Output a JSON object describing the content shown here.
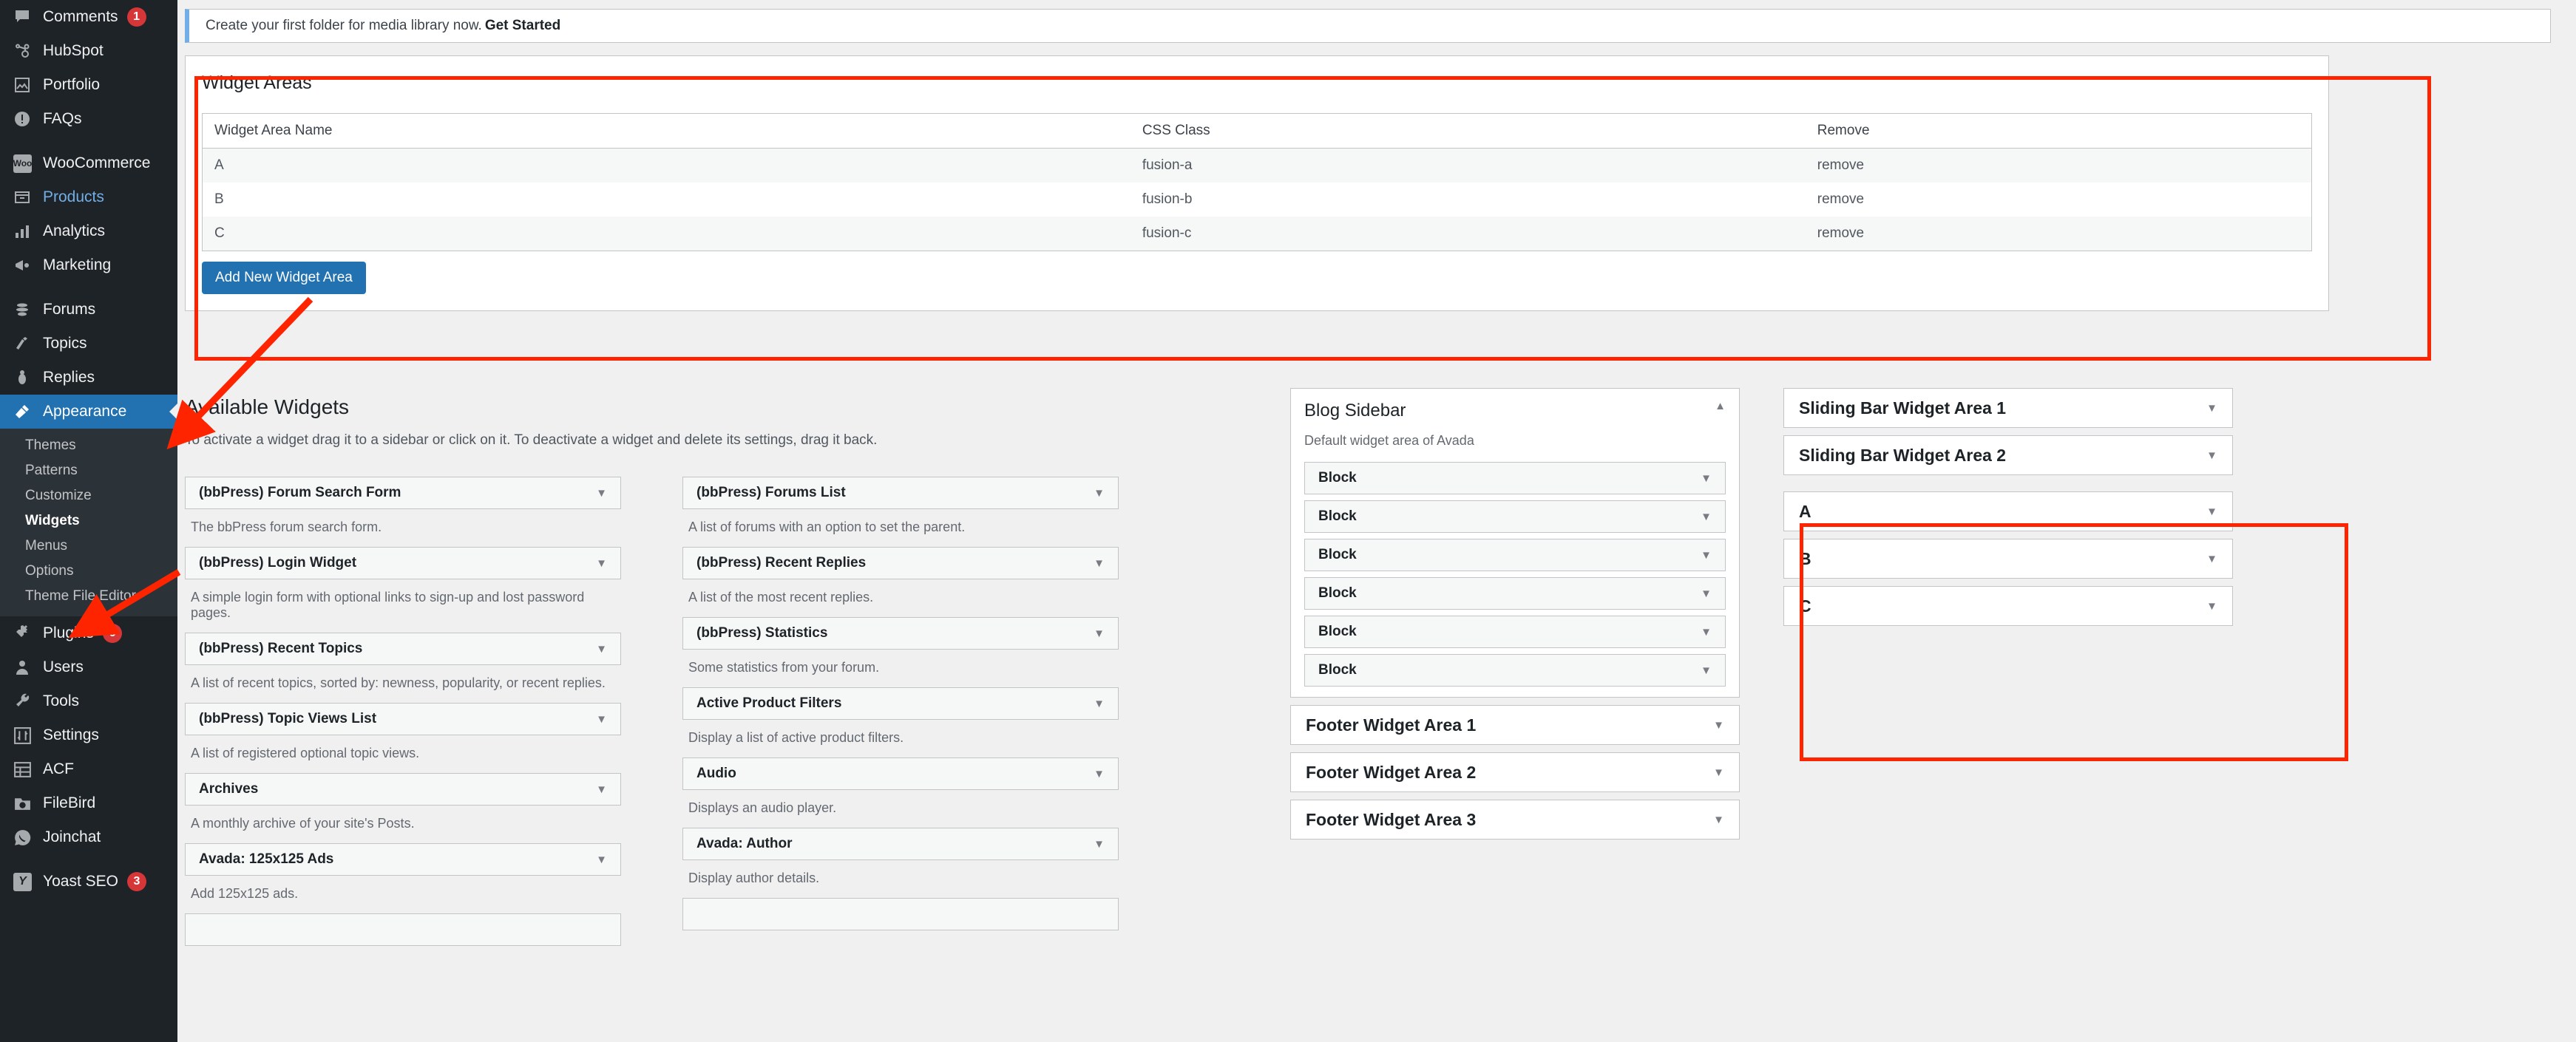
{
  "sidebar": {
    "items": [
      {
        "label": "Comments",
        "icon": "comment-icon",
        "badge": "1"
      },
      {
        "label": "HubSpot",
        "icon": "hubspot-icon"
      },
      {
        "label": "Portfolio",
        "icon": "portfolio-icon"
      },
      {
        "label": "FAQs",
        "icon": "faq-icon"
      },
      {
        "label": "WooCommerce",
        "icon": "woo-icon"
      },
      {
        "label": "Products",
        "icon": "products-icon"
      },
      {
        "label": "Analytics",
        "icon": "analytics-icon"
      },
      {
        "label": "Marketing",
        "icon": "megaphone-icon"
      },
      {
        "label": "Forums",
        "icon": "forums-icon"
      },
      {
        "label": "Topics",
        "icon": "topics-icon"
      },
      {
        "label": "Replies",
        "icon": "replies-icon"
      },
      {
        "label": "Appearance",
        "icon": "brush-icon"
      }
    ],
    "appearance_submenu": [
      {
        "label": "Themes"
      },
      {
        "label": "Patterns"
      },
      {
        "label": "Customize"
      },
      {
        "label": "Widgets"
      },
      {
        "label": "Menus"
      },
      {
        "label": "Options"
      },
      {
        "label": "Theme File Editor"
      }
    ],
    "items_after": [
      {
        "label": "Plugins",
        "icon": "plugin-icon",
        "badge": "6"
      },
      {
        "label": "Users",
        "icon": "user-icon"
      },
      {
        "label": "Tools",
        "icon": "wrench-icon"
      },
      {
        "label": "Settings",
        "icon": "settings-icon"
      },
      {
        "label": "ACF",
        "icon": "acf-icon"
      },
      {
        "label": "FileBird",
        "icon": "filebird-icon"
      },
      {
        "label": "Joinchat",
        "icon": "joinchat-icon"
      },
      {
        "label": "Yoast SEO",
        "icon": "yoast-icon",
        "badge": "3"
      }
    ]
  },
  "notice": {
    "text": "Create your first folder for media library now.",
    "link": "Get Started"
  },
  "widget_areas": {
    "title": "Widget Areas",
    "columns": [
      "Widget Area Name",
      "CSS Class",
      "Remove"
    ],
    "rows": [
      {
        "name": "A",
        "css": "fusion-a",
        "remove": "remove"
      },
      {
        "name": "B",
        "css": "fusion-b",
        "remove": "remove"
      },
      {
        "name": "C",
        "css": "fusion-c",
        "remove": "remove"
      }
    ],
    "add_button": "Add New Widget Area"
  },
  "available_widgets": {
    "title": "Available Widgets",
    "description": "To activate a widget drag it to a sidebar or click on it. To deactivate a widget and delete its settings, drag it back.",
    "left": [
      {
        "name": "(bbPress) Forum Search Form",
        "desc": "The bbPress forum search form."
      },
      {
        "name": "(bbPress) Login Widget",
        "desc": "A simple login form with optional links to sign-up and lost password pages."
      },
      {
        "name": "(bbPress) Recent Topics",
        "desc": "A list of recent topics, sorted by: newness, popularity, or recent replies."
      },
      {
        "name": "(bbPress) Topic Views List",
        "desc": "A list of registered optional topic views."
      },
      {
        "name": "Archives",
        "desc": "A monthly archive of your site's Posts."
      },
      {
        "name": "Avada: 125x125 Ads",
        "desc": "Add 125x125 ads."
      }
    ],
    "right": [
      {
        "name": "(bbPress) Forums List",
        "desc": "A list of forums with an option to set the parent."
      },
      {
        "name": "(bbPress) Recent Replies",
        "desc": "A list of the most recent replies."
      },
      {
        "name": "(bbPress) Statistics",
        "desc": "Some statistics from your forum."
      },
      {
        "name": "Active Product Filters",
        "desc": "Display a list of active product filters."
      },
      {
        "name": "Audio",
        "desc": "Displays an audio player."
      },
      {
        "name": "Avada: Author",
        "desc": "Display author details."
      }
    ]
  },
  "blog_sidebar": {
    "title": "Blog Sidebar",
    "subtitle": "Default widget area of Avada",
    "blocks": [
      "Block",
      "Block",
      "Block",
      "Block",
      "Block",
      "Block"
    ]
  },
  "footer_areas": [
    "Footer Widget Area 1",
    "Footer Widget Area 2",
    "Footer Widget Area 3"
  ],
  "sliding_areas": [
    "Sliding Bar Widget Area 1",
    "Sliding Bar Widget Area 2"
  ],
  "custom_areas": [
    "A",
    "B",
    "C"
  ],
  "colors": {
    "accent": "#2271b1",
    "highlight": "#ff2400",
    "sidebar_bg": "#1d2327",
    "badge": "#d63638",
    "link_blue": "#72aee6"
  }
}
